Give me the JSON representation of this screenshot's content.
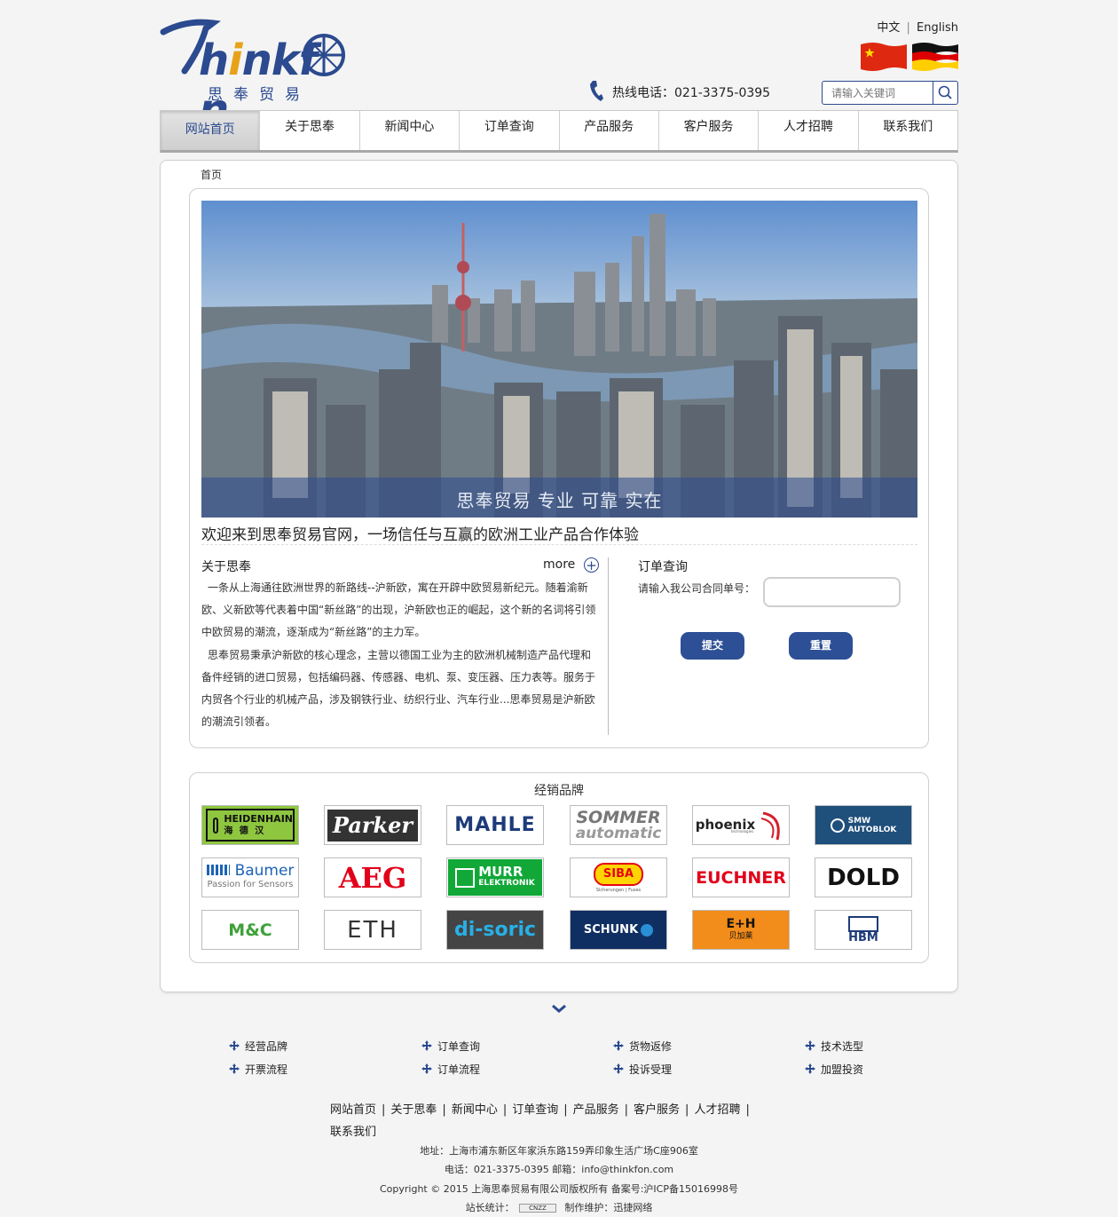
{
  "header": {
    "logo_text": "Thinkfon",
    "logo_sub": "思奉贸易",
    "lang_cn": "中文",
    "lang_sep": "|",
    "lang_en": "English",
    "hotline": "热线电话：021-3375-0395",
    "search_placeholder": "请输入关键词"
  },
  "nav": [
    "网站首页",
    "关于思奉",
    "新闻中心",
    "订单查询",
    "产品服务",
    "客户服务",
    "人才招聘",
    "联系我们"
  ],
  "breadcrumb": "首页",
  "banner_caption": "思奉贸易 专业 可靠 实在",
  "welcome": "欢迎来到思奉贸易官网，一场信任与互赢的欧洲工业产品合作体验",
  "about": {
    "title": "关于思奉",
    "more": "more",
    "para1": "一条从上海通往欧洲世界的新路线--沪新欧，寓在开辟中欧贸易新纪元。随着渝新欧、义新欧等代表着中国“新丝路”的出现，沪新欧也正的崛起，这个新的名词将引领中欧贸易的潮流，逐渐成为“新丝路”的主力军。",
    "para2": "思奉贸易秉承沪新欧的核心理念，主营以德国工业为主的欧洲机械制造产品代理和备件经销的进口贸易，包括编码器、传感器、电机、泵、变压器、压力表等。服务于内贸各个行业的机械产品，涉及钢铁行业、纺织行业、汽车行业...思奉贸易是沪新欧的潮流引领者。"
  },
  "order": {
    "title": "订单查询",
    "label": "请输入我公司合同单号：",
    "submit": "提交",
    "reset": "重置"
  },
  "brands": {
    "title": "经销品牌",
    "items": [
      {
        "main": "HEIDENHAIN",
        "sub": "海 德 汉"
      },
      {
        "main": "Parker",
        "sub": ""
      },
      {
        "main": "MAHLE",
        "sub": ""
      },
      {
        "main": "SOMMER",
        "sub": "automatic"
      },
      {
        "main": "phoenix",
        "sub": "technologies"
      },
      {
        "main": "SMW",
        "sub": "AUTOBLOK"
      },
      {
        "main": "Baumer",
        "sub": "Passion for Sensors"
      },
      {
        "main": "AEG",
        "sub": ""
      },
      {
        "main": "MURR",
        "sub": "ELEKTRONIK"
      },
      {
        "main": "SIBA",
        "sub": "Sicherungen | Fuses"
      },
      {
        "main": "EUCHNER",
        "sub": ""
      },
      {
        "main": "DOLD",
        "sub": ""
      },
      {
        "main": "M&C",
        "sub": ""
      },
      {
        "main": "ETH",
        "sub": ""
      },
      {
        "main": "di-soric",
        "sub": ""
      },
      {
        "main": "SCHUNK",
        "sub": ""
      },
      {
        "main": "E+H",
        "sub": "贝加莱"
      },
      {
        "main": "HBM",
        "sub": ""
      }
    ]
  },
  "footer": {
    "links_row1": [
      "经营品牌",
      "订单查询",
      "货物返修",
      "技术选型"
    ],
    "links_row2": [
      "开票流程",
      "订单流程",
      "投诉受理",
      "加盟投资"
    ],
    "nav": [
      "网站首页",
      "关于思奉",
      "新闻中心",
      "订单查询",
      "产品服务",
      "客户服务",
      "人才招聘",
      "联系我们"
    ],
    "address": "地址：上海市浦东新区年家浜东路159弄印象生活广场C座906室",
    "contact": "电话：021-3375-0395 邮箱：info@thinkfon.com",
    "copyright": "Copyright © 2015 上海思奉贸易有限公司版权所有 备案号:沪ICP备15016998号",
    "stats_label": "站长统计：",
    "stats_badge": "CNZZ",
    "maker": "制作维护：迅捷网络"
  },
  "colors": {
    "brand_blue": "#2b4a8f",
    "button_blue": "#2d4f95"
  }
}
